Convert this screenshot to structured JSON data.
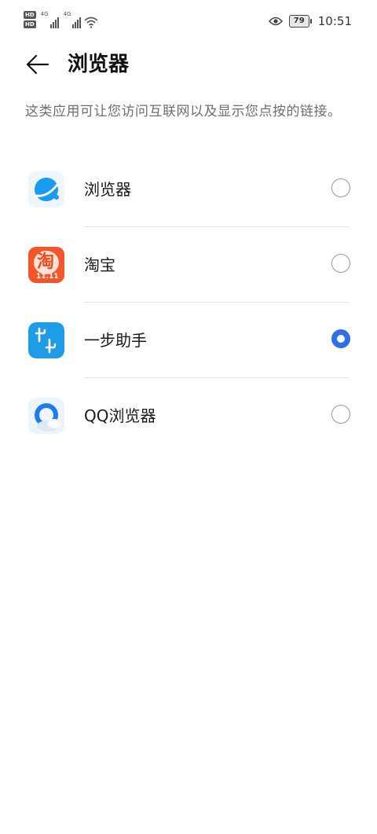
{
  "status_bar": {
    "hd1": "HD",
    "hd2": "HD",
    "sig1_label": "4G",
    "sig2_label": "4G",
    "battery": "79",
    "time": "10:51",
    "icons": [
      "signal-icon",
      "wifi-icon",
      "eye-icon",
      "battery-icon"
    ]
  },
  "header": {
    "title": "浏览器",
    "back_icon": "back-arrow-icon"
  },
  "description": "这类应用可让您访问互联网以及显示您点按的链接。",
  "apps": [
    {
      "name": "浏览器",
      "icon": "huawei-browser-icon",
      "selected": false
    },
    {
      "name": "淘宝",
      "icon": "taobao-icon",
      "selected": false
    },
    {
      "name": "一步助手",
      "icon": "yibu-assistant-icon",
      "selected": true
    },
    {
      "name": "QQ浏览器",
      "icon": "qq-browser-icon",
      "selected": false
    }
  ],
  "colors": {
    "accent": "#2f6fe4",
    "taobao": "#f5552b",
    "yibu": "#1e9ce6",
    "browser": "#1a9bf0"
  },
  "icon_text": {
    "taobao_glyph": "淘",
    "taobao_badge": "11.11",
    "yibu_glyph": "ษษ"
  }
}
